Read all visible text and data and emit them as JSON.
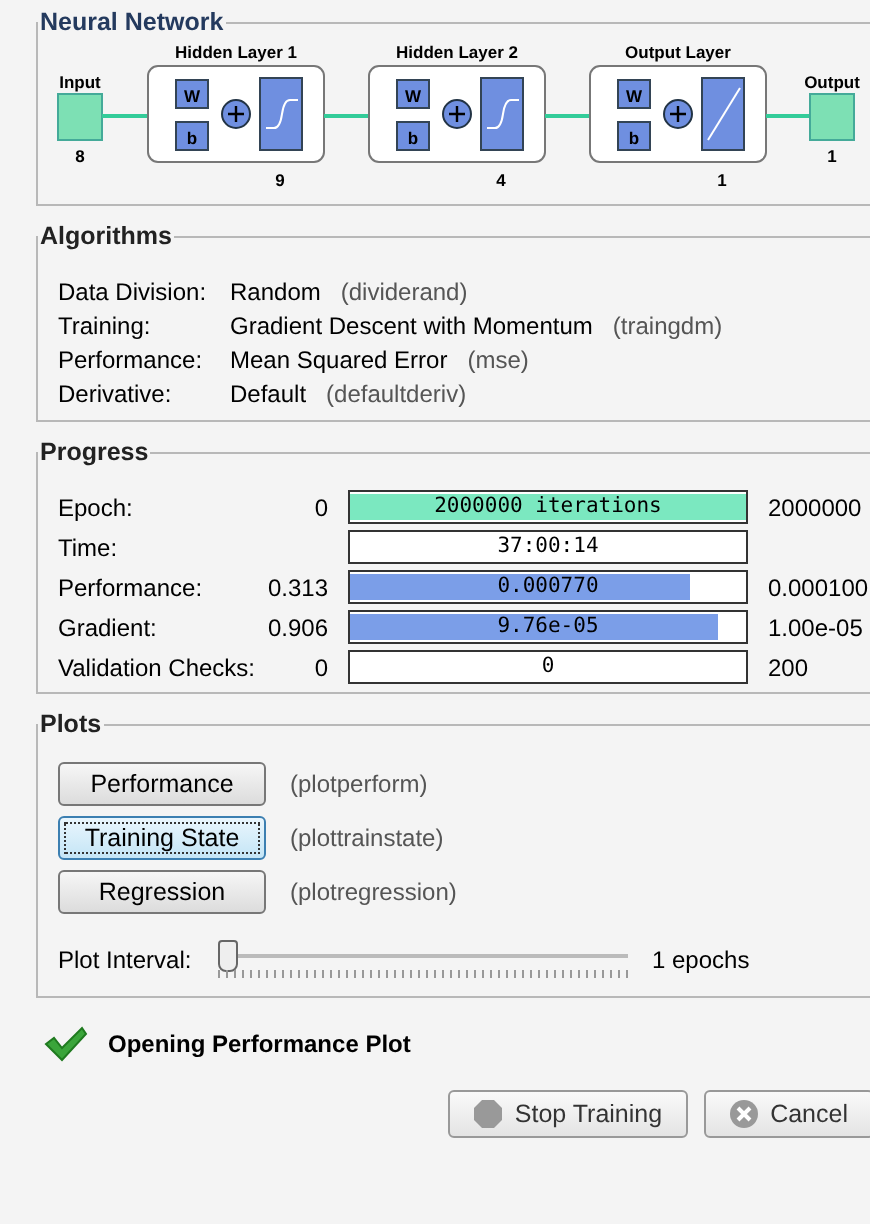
{
  "network": {
    "title": "Neural Network",
    "input": {
      "label": "Input",
      "size": "8"
    },
    "output": {
      "label": "Output",
      "size": "1"
    },
    "layers": [
      {
        "title": "Hidden Layer 1",
        "size": "9",
        "weight": "W",
        "bias": "b",
        "kind": "sigmoid"
      },
      {
        "title": "Hidden Layer 2",
        "size": "4",
        "weight": "W",
        "bias": "b",
        "kind": "sigmoid"
      },
      {
        "title": "Output Layer",
        "size": "1",
        "weight": "W",
        "bias": "b",
        "kind": "linear"
      }
    ]
  },
  "algorithms": {
    "title": "Algorithms",
    "rows": [
      {
        "label": "Data Division:",
        "value": "Random",
        "function": "(dividerand)"
      },
      {
        "label": "Training:",
        "value": "Gradient Descent with Momentum",
        "function": "(traingdm)"
      },
      {
        "label": "Performance:",
        "value": "Mean Squared Error",
        "function": "(mse)"
      },
      {
        "label": "Derivative:",
        "value": "Default",
        "function": "(defaultderiv)"
      }
    ]
  },
  "progress": {
    "title": "Progress",
    "rows": [
      {
        "label": "Epoch:",
        "start": "0",
        "bar_text": "2000000 iterations",
        "level": 1,
        "color": "#7be8c0",
        "end": "2000000"
      },
      {
        "label": "Time:",
        "bar_text": "37:00:14",
        "level": 0
      },
      {
        "label": "Performance:",
        "start": "0.313",
        "bar_text": "0.000770",
        "level": 0.86,
        "color": "#7b9ee8",
        "end": "0.000100"
      },
      {
        "label": "Gradient:",
        "start": "0.906",
        "bar_text": "9.76e-05",
        "level": 0.93,
        "color": "#7b9ee8",
        "end": "1.00e-05"
      },
      {
        "label": "Validation Checks:",
        "start": "0",
        "bar_text": "0",
        "level": 0,
        "end": "200"
      }
    ]
  },
  "plots": {
    "title": "Plots",
    "items": [
      {
        "button": "Performance",
        "function": "(plotperform)",
        "selected": false
      },
      {
        "button": "Training State",
        "function": "(plottrainstate)",
        "selected": true
      },
      {
        "button": "Regression",
        "function": "(plotregression)",
        "selected": false
      }
    ],
    "interval": {
      "label": "Plot Interval:",
      "level": 0,
      "reading": "1 epochs"
    }
  },
  "status": {
    "text": "Opening Performance Plot"
  },
  "buttons": [
    {
      "label": "Stop Training",
      "kind": "stop"
    },
    {
      "label": "Cancel",
      "kind": "cancel"
    }
  ]
}
